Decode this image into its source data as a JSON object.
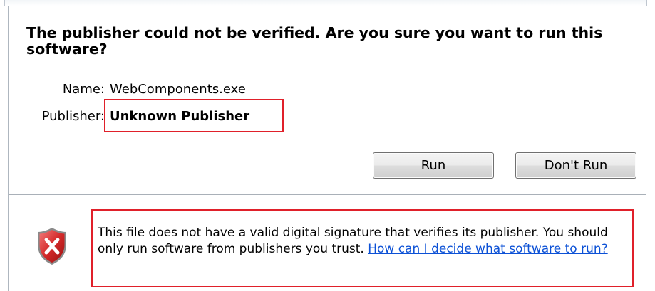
{
  "dialog": {
    "title": "The publisher could not be verified.  Are you sure you want to run this software?",
    "name_label": "Name:",
    "name_value": "WebComponents.exe",
    "publisher_label": "Publisher:",
    "publisher_value": "Unknown Publisher",
    "buttons": {
      "run": "Run",
      "dont_run": "Don't Run"
    },
    "warning": {
      "icon": "shield-error-icon",
      "text": "This file does not have a valid digital signature that verifies its publisher. You should only run software from publishers you trust. ",
      "link": "How can I decide what software to run?"
    }
  },
  "colors": {
    "highlight": "#e0202a",
    "link": "#0c51d6",
    "shield_red": "#c8202a"
  }
}
